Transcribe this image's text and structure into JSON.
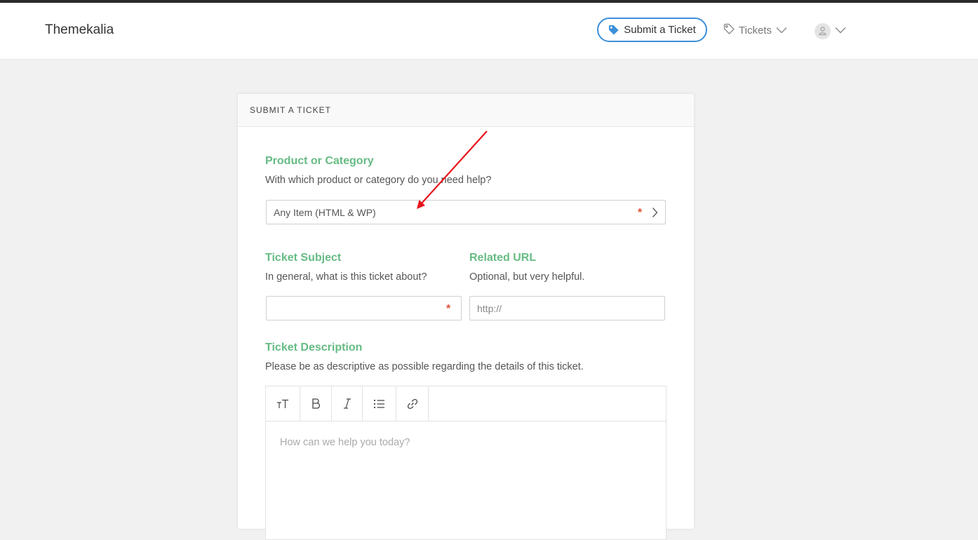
{
  "header": {
    "brand": "Themekalia",
    "submit_label": "Submit a Ticket",
    "tickets_label": "Tickets",
    "accent_color": "#3b8fd9"
  },
  "card": {
    "title": "SUBMIT A TICKET",
    "product": {
      "label": "Product or Category",
      "help": "With which product or category do you need help?",
      "value": "Any Item (HTML & WP)",
      "required_mark": "*"
    },
    "subject": {
      "label": "Ticket Subject",
      "help": "In general, what is this ticket about?",
      "value": "",
      "required_mark": "*"
    },
    "url": {
      "label": "Related URL",
      "help": "Optional, but very helpful.",
      "placeholder": "http://"
    },
    "description": {
      "label": "Ticket Description",
      "help": "Please be as descriptive as possible regarding the details of this ticket.",
      "placeholder": "How can we help you today?",
      "toolbar": [
        "text-size-icon",
        "bold-icon",
        "italic-icon",
        "list-icon",
        "link-icon"
      ]
    }
  },
  "colors": {
    "label_green": "#66bb84",
    "required_red": "#e0533a",
    "annotation_red": "#e8141b"
  }
}
